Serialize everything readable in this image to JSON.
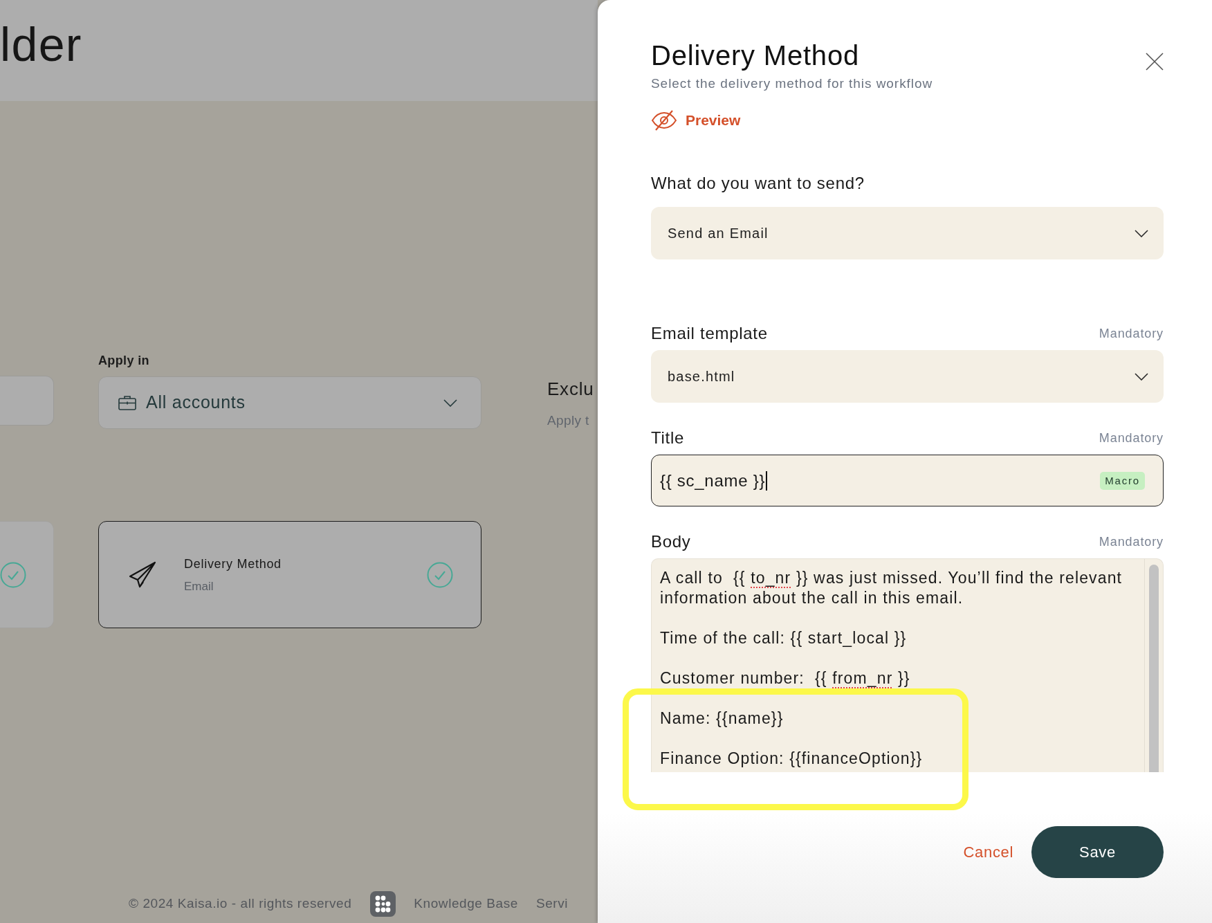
{
  "page": {
    "heading": "lder",
    "filters": [
      {
        "kind": "blank"
      },
      {
        "kind": "select",
        "label": "Apply in",
        "value": "All accounts"
      },
      {
        "kind": "section",
        "title": "Exclu",
        "description": "Apply t"
      }
    ],
    "steps": [
      {
        "selected": false,
        "done": true
      },
      {
        "title": "Delivery Method",
        "subtitle": "Email",
        "selected": true,
        "done": true
      }
    ],
    "footer": {
      "copyright": "© 2024 Kaisa.io - all rights reserved",
      "links": [
        "Knowledge Base",
        "Servi"
      ]
    }
  },
  "drawer": {
    "title": "Delivery Method",
    "subtitle": "Select the delivery method for this workflow",
    "preview": "Preview",
    "send": {
      "label": "What do you want to send?",
      "value": "Send an Email"
    },
    "fields": [
      {
        "kind": "select",
        "label": "Email template",
        "note": "Mandatory",
        "value": "base.html"
      },
      {
        "kind": "text",
        "label": "Title",
        "note": "Mandatory",
        "value": "{{ sc_name }}",
        "focused": true,
        "tag": "Macro"
      },
      {
        "kind": "rich",
        "label": "Body",
        "note": "Mandatory",
        "paragraphs": [
          {
            "segments": [
              {
                "text": "A call to  {{ ",
                "flagged": false
              },
              {
                "text": "to_nr",
                "flagged": true
              },
              {
                "text": " }} was just missed. You’ll find the relevant information about the call in this email.",
                "flagged": false
              }
            ]
          },
          {
            "segments": [
              {
                "text": "Time of the call: {{ start_local }}",
                "flagged": false
              }
            ]
          },
          {
            "segments": [
              {
                "text": "Customer number:  {{ ",
                "flagged": false
              },
              {
                "text": "from_nr",
                "flagged": true
              },
              {
                "text": " }}",
                "flagged": false
              }
            ]
          },
          {
            "segments": [
              {
                "text": "Name: {{name}}",
                "flagged": false
              }
            ]
          },
          {
            "segments": [
              {
                "text": "Finance Option: {{financeOption}}",
                "flagged": false
              }
            ]
          }
        ]
      }
    ],
    "cancel": "Cancel",
    "save": "Save"
  },
  "annotations": [
    {
      "kind": "highlight-frame"
    }
  ]
}
